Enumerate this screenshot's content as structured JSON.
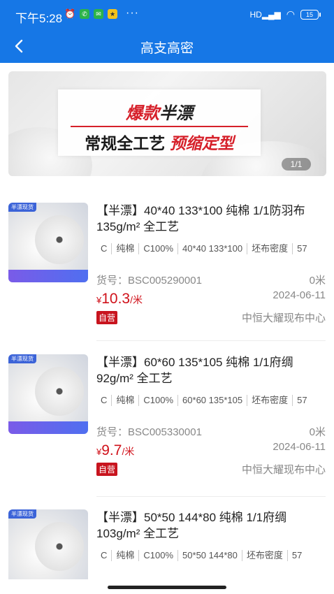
{
  "status_bar": {
    "time": "下午5:28",
    "battery": "15",
    "network": "HD"
  },
  "header": {
    "title": "高支高密"
  },
  "banner": {
    "line1_red": "爆款",
    "line1_black": "半漂",
    "line2_black": "常规全工艺",
    "line2_red": "预缩定型",
    "pager": "1/1"
  },
  "products": [
    {
      "title": "【半漂】40*40 133*100 纯棉 1/1防羽布 135g/m² 全工艺",
      "specs": [
        "C",
        "纯棉",
        "C100%",
        "40*40 133*100",
        "坯布密度",
        "57"
      ],
      "sku": "货号：BSC005290001",
      "quantity": "0米",
      "price_currency": "¥",
      "price": "10.3",
      "price_unit": "/米",
      "date": "2024-06-11",
      "badge": "自营",
      "supplier": "中恒大耀现布中心",
      "thumb_tag": "半漂现货"
    },
    {
      "title": "【半漂】60*60 135*105 纯棉 1/1府绸 92g/m² 全工艺",
      "specs": [
        "C",
        "纯棉",
        "C100%",
        "60*60 135*105",
        "坯布密度",
        "57"
      ],
      "sku": "货号：BSC005330001",
      "quantity": "0米",
      "price_currency": "¥",
      "price": "9.7",
      "price_unit": "/米",
      "date": "2024-06-11",
      "badge": "自营",
      "supplier": "中恒大耀现布中心",
      "thumb_tag": "半漂现货"
    },
    {
      "title": "【半漂】50*50 144*80 纯棉 1/1府绸 103g/m² 全工艺",
      "specs": [
        "C",
        "纯棉",
        "C100%",
        "50*50 144*80",
        "坯布密度",
        "57"
      ],
      "thumb_tag": "半漂现货"
    }
  ]
}
